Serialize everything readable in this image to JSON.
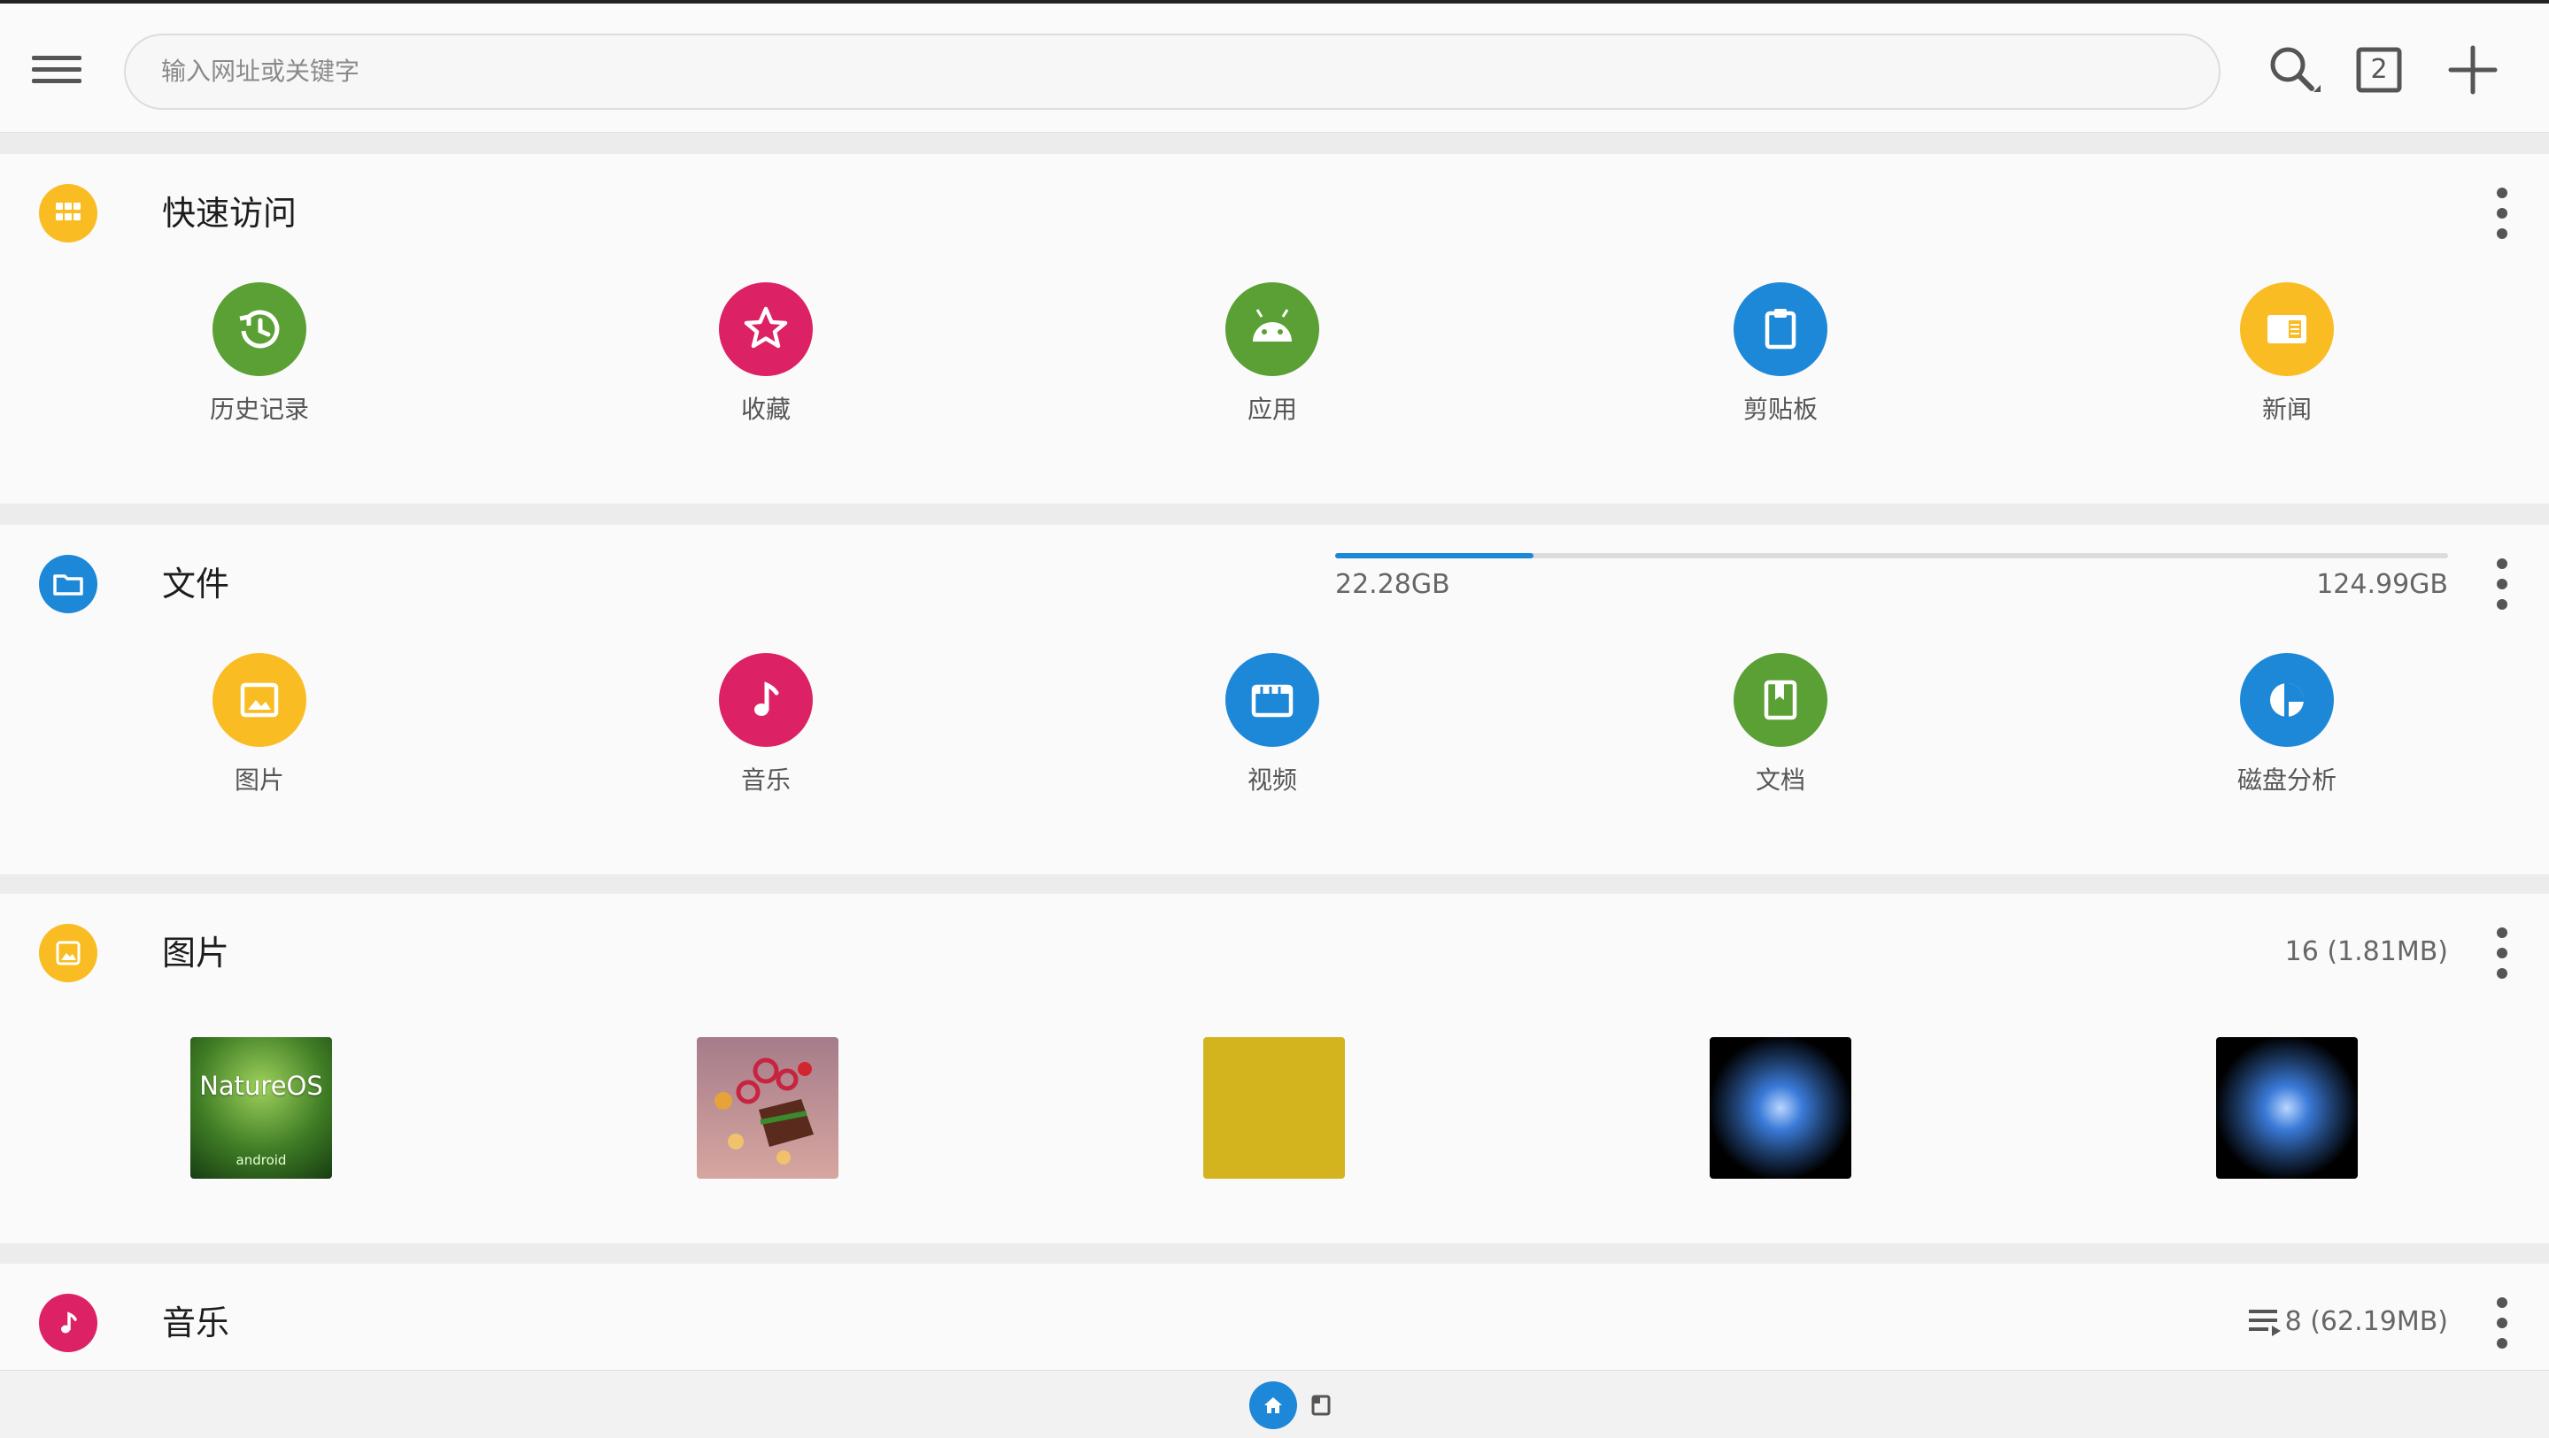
{
  "topbar": {
    "address_placeholder": "输入网址或关键字",
    "tab_count": "2"
  },
  "quick_access": {
    "title": "快速访问",
    "color": "#f9bd23",
    "items": [
      {
        "label": "历史记录",
        "icon": "history-icon",
        "color": "#5aa035"
      },
      {
        "label": "收藏",
        "icon": "star-icon",
        "color": "#dc2264"
      },
      {
        "label": "应用",
        "icon": "android-icon",
        "color": "#5aa035"
      },
      {
        "label": "剪贴板",
        "icon": "clipboard-icon",
        "color": "#1e88d8"
      },
      {
        "label": "新闻",
        "icon": "news-icon",
        "color": "#f9bd23"
      }
    ]
  },
  "files": {
    "title": "文件",
    "color": "#1e88d8",
    "storage_used": "22.28GB",
    "storage_total": "124.99GB",
    "storage_fraction": 0.178,
    "items": [
      {
        "label": "图片",
        "icon": "image-icon",
        "color": "#f9bd23"
      },
      {
        "label": "音乐",
        "icon": "music-note-icon",
        "color": "#dc2264"
      },
      {
        "label": "视频",
        "icon": "video-icon",
        "color": "#1e88d8"
      },
      {
        "label": "文档",
        "icon": "document-icon",
        "color": "#5aa035"
      },
      {
        "label": "磁盘分析",
        "icon": "pie-chart-icon",
        "color": "#1e88d8"
      }
    ]
  },
  "pictures": {
    "title": "图片",
    "color": "#f9bd23",
    "count": "16 (1.81MB)",
    "thumbs": [
      {
        "name": "natureos-wallpaper",
        "text": "NatureOS",
        "subtext": "android"
      },
      {
        "name": "sweets-illustration"
      },
      {
        "name": "mustard-swatch",
        "color": "#d3b41f"
      },
      {
        "name": "blue-glow-image-1"
      },
      {
        "name": "blue-glow-image-2"
      }
    ]
  },
  "music": {
    "title": "音乐",
    "color": "#dc2264",
    "count": "8 (62.19MB)"
  }
}
